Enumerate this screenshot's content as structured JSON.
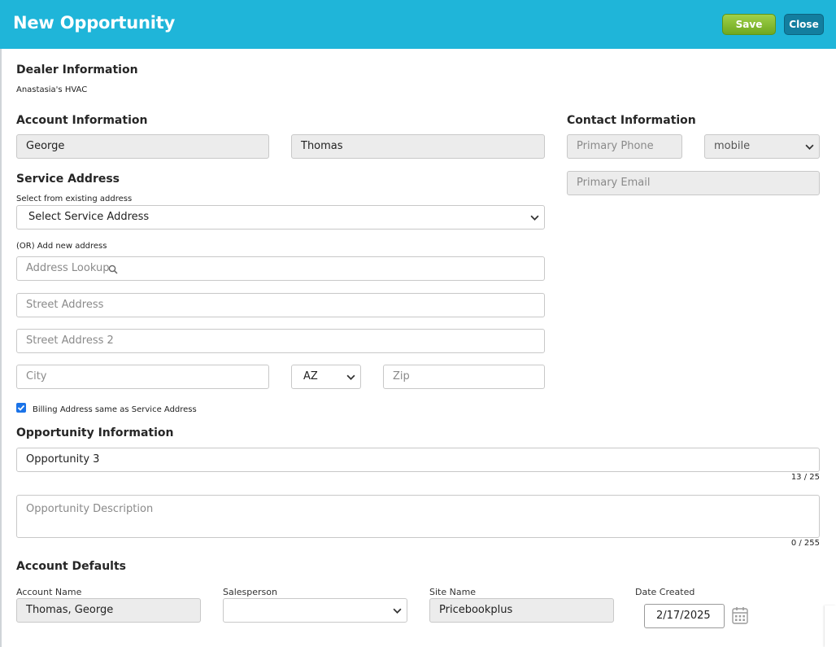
{
  "header": {
    "title": "New Opportunity",
    "save_label": "Save",
    "close_label": "Close"
  },
  "dealer": {
    "heading": "Dealer Information",
    "name": "Anastasia's HVAC"
  },
  "account": {
    "heading": "Account Information",
    "first_name": "George",
    "last_name": "Thomas"
  },
  "contact": {
    "heading": "Contact Information",
    "phone_placeholder": "Primary Phone",
    "phone_type": "mobile",
    "email_placeholder": "Primary Email"
  },
  "service_address": {
    "heading": "Service Address",
    "select_label": "Select from existing address",
    "select_value": "Select Service Address",
    "add_new_label": "(OR) Add new address",
    "lookup_placeholder": "Address Lookup",
    "street_placeholder": "Street Address",
    "street2_placeholder": "Street Address 2",
    "city_placeholder": "City",
    "state_value": "AZ",
    "zip_placeholder": "Zip",
    "billing_same_label": "Billing Address same as Service Address",
    "billing_same_checked": true
  },
  "opportunity": {
    "heading": "Opportunity Information",
    "name_value": "Opportunity 3",
    "name_counter": "13 / 25",
    "description_placeholder": "Opportunity Description",
    "description_counter": "0 / 255"
  },
  "defaults": {
    "heading": "Account Defaults",
    "account_name_label": "Account Name",
    "account_name_value": "Thomas, George",
    "salesperson_label": "Salesperson",
    "salesperson_value": "",
    "site_name_label": "Site Name",
    "site_name_value": "Pricebookplus",
    "date_created_label": "Date Created",
    "date_created_value": "2/17/2025"
  },
  "colors": {
    "header": "#1fb5d9",
    "save": "#8cc63f",
    "close": "#137e9f",
    "checkbox": "#1a73e8"
  }
}
